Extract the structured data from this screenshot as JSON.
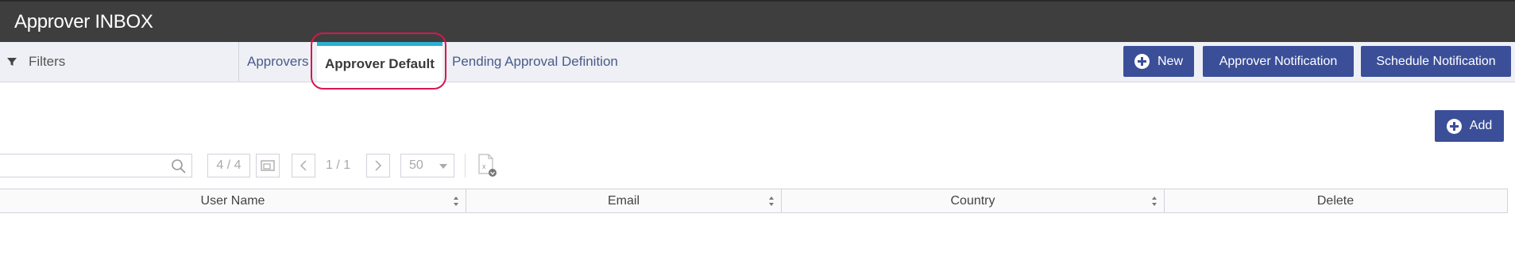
{
  "window": {
    "title": "Approver INBOX"
  },
  "filters": {
    "label": "Filters",
    "icon": "filter-icon"
  },
  "tabs": [
    {
      "label": "Approvers",
      "active": false
    },
    {
      "label": "Approver Default",
      "active": true
    },
    {
      "label": "Pending Approval Definition",
      "active": false
    }
  ],
  "header_buttons": {
    "new_label": "New",
    "approver_notification_label": "Approver Notification",
    "schedule_notification_label": "Schedule Notification"
  },
  "add_button": {
    "label": "Add"
  },
  "pager": {
    "record_count": "4 / 4",
    "page": "1 / 1",
    "page_size": "50"
  },
  "table": {
    "columns": [
      "User Name",
      "Email",
      "Country",
      "Delete"
    ],
    "rows": []
  },
  "colors": {
    "titlebar": "#3e3e3e",
    "button": "#3b4f98",
    "active_tab_accent": "#2bb0d6",
    "highlight": "#d6174f"
  }
}
